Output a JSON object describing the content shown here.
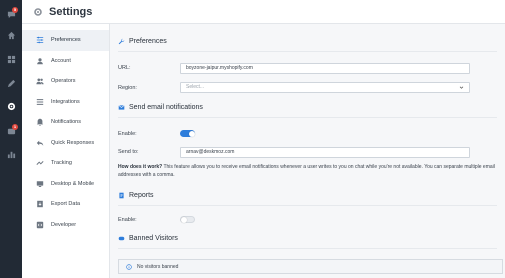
{
  "header": {
    "title": "Settings"
  },
  "rail": {
    "badges": {
      "chats": "5",
      "tickets": "1"
    }
  },
  "sidebar": {
    "items": [
      {
        "label": "Preferences",
        "icon": "sliders-icon"
      },
      {
        "label": "Account",
        "icon": "user-icon"
      },
      {
        "label": "Operators",
        "icon": "users-icon"
      },
      {
        "label": "Integrations",
        "icon": "list-icon"
      },
      {
        "label": "Notifications",
        "icon": "bell-icon"
      },
      {
        "label": "Quick Responses",
        "icon": "reply-icon"
      },
      {
        "label": "Tracking",
        "icon": "trend-icon"
      },
      {
        "label": "Desktop & Mobile",
        "icon": "desktop-icon"
      },
      {
        "label": "Export Data",
        "icon": "download-icon"
      },
      {
        "label": "Developer",
        "icon": "code-icon"
      }
    ]
  },
  "preferences": {
    "heading": "Preferences",
    "url_label": "URL:",
    "url_value": "boyzone-jaipur.myshopify.com",
    "region_label": "Region:",
    "region_placeholder": "Select..."
  },
  "email": {
    "heading": "Send email notifications",
    "enable_label": "Enable:",
    "enabled": true,
    "sendto_label": "Send to:",
    "sendto_value": "arnav@deskmoz.com",
    "help_bold": "How does it work?",
    "help_text": " This feature allows you to receive email notifications whenever a user writes to you on chat while you're not available. You can separate multiple email addresses with a comma."
  },
  "reports": {
    "heading": "Reports",
    "enable_label": "Enable:",
    "enabled": false
  },
  "banned": {
    "heading": "Banned Visitors",
    "message": "No visitors banned"
  },
  "colors": {
    "accent": "#2e7ddb",
    "rail": "#222a35",
    "badge": "#e0483e"
  }
}
